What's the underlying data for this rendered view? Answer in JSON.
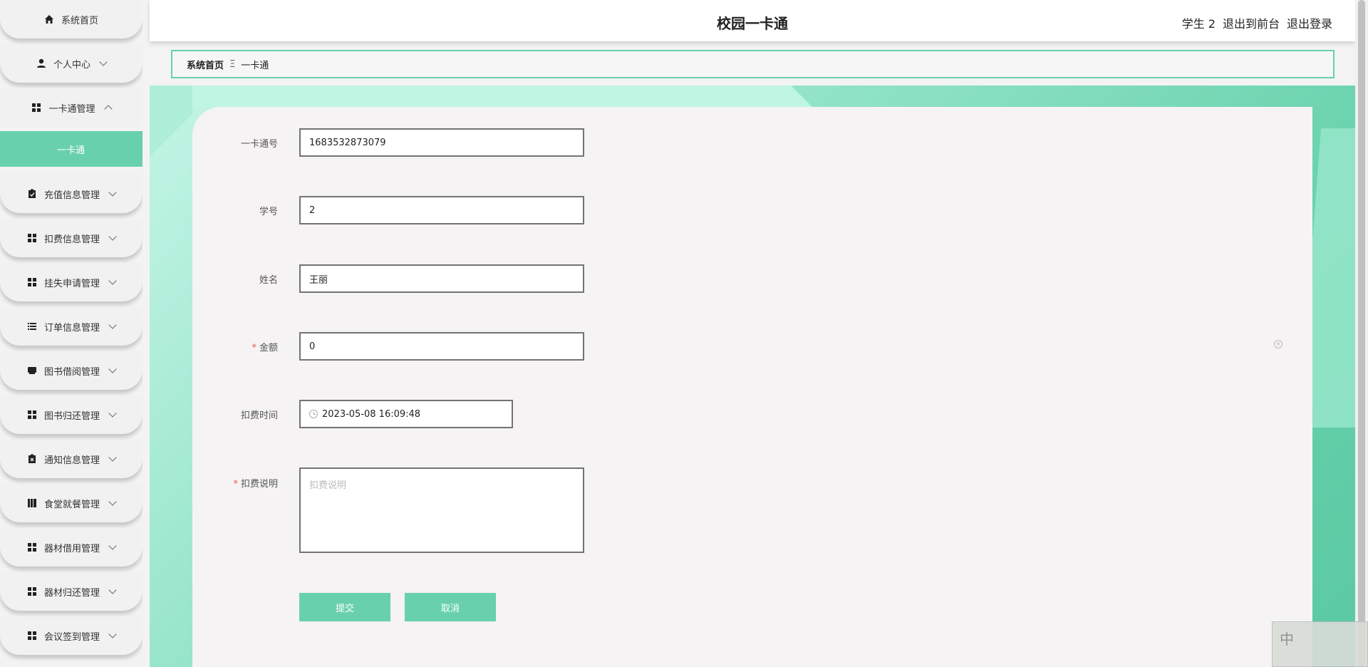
{
  "header": {
    "title": "校园一卡通",
    "user": "学生 2",
    "to_front": "退出到前台",
    "logout": "退出登录"
  },
  "breadcrumb": {
    "home": "系统首页",
    "separator": "Ξ",
    "current": "一卡通"
  },
  "sidebar": {
    "items": [
      {
        "label": "系统首页",
        "icon": "home-icon"
      },
      {
        "label": "个人中心",
        "icon": "user-icon"
      },
      {
        "label": "一卡通管理",
        "icon": "grid-icon"
      },
      {
        "label": "充值信息管理",
        "icon": "clipboard-icon"
      },
      {
        "label": "扣费信息管理",
        "icon": "grid-icon"
      },
      {
        "label": "挂失申请管理",
        "icon": "grid-icon"
      },
      {
        "label": "订单信息管理",
        "icon": "list-icon"
      },
      {
        "label": "图书借阅管理",
        "icon": "book-icon"
      },
      {
        "label": "图书归还管理",
        "icon": "grid-icon"
      },
      {
        "label": "通知信息管理",
        "icon": "clipboard-x-icon"
      },
      {
        "label": "食堂就餐管理",
        "icon": "books-icon"
      },
      {
        "label": "器材借用管理",
        "icon": "grid-icon"
      },
      {
        "label": "器材归还管理",
        "icon": "grid-icon"
      },
      {
        "label": "会议签到管理",
        "icon": "grid-icon"
      }
    ],
    "active_sub": "一卡通"
  },
  "form": {
    "card_no": {
      "label": "一卡通号",
      "value": "1683532873079"
    },
    "student_no": {
      "label": "学号",
      "value": "2"
    },
    "name": {
      "label": "姓名",
      "value": "王丽"
    },
    "amount": {
      "label": "金额",
      "value": "0"
    },
    "deduct_time": {
      "label": "扣费时间",
      "value": "2023-05-08 16:09:48"
    },
    "deduct_desc": {
      "label": "扣费说明",
      "placeholder": "扣费说明"
    },
    "submit": "提交",
    "cancel": "取消"
  },
  "ime": {
    "lang": "中"
  },
  "colors": {
    "accent": "#69d0ad"
  }
}
